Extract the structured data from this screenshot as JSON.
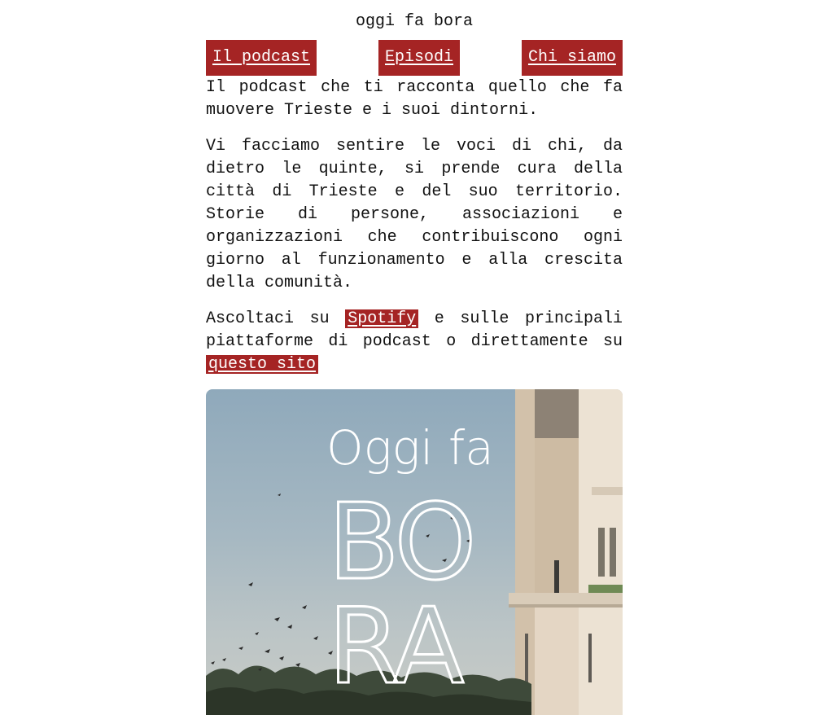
{
  "header": {
    "site_title": "oggi fa bora"
  },
  "nav": {
    "items": [
      {
        "label": "Il podcast"
      },
      {
        "label": "Episodi"
      },
      {
        "label": "Chi siamo"
      }
    ]
  },
  "intro": {
    "tagline": "Il podcast che ti racconta quello che fa muovere Trieste e i suoi dintorni.",
    "description": "Vi facciamo sentire le voci di chi, da dietro le quinte, si prende cura della città di Trieste e del suo territorio. Storie di persone, associazioni e organizzazioni che contribuiscono ogni giorno al funzionamento e alla crescita della comunità.",
    "listen_prefix": "Ascoltaci su ",
    "spotify_link": "Spotify",
    "listen_middle": " e sulle principali piattaforme di podcast o direttamente su ",
    "site_link": "questo sito"
  },
  "cover": {
    "title_line1": "Oggi fa",
    "title_line2": "BO",
    "title_line3": "RA"
  },
  "colors": {
    "accent": "#a52424",
    "text": "#111111",
    "background": "#ffffff"
  }
}
